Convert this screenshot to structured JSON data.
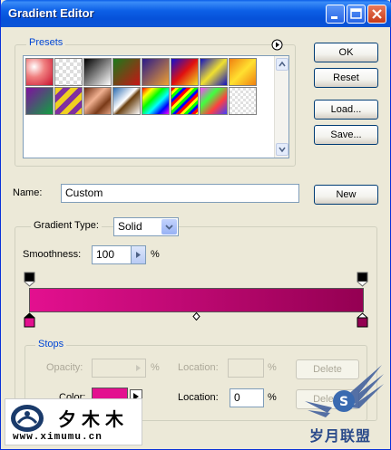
{
  "window": {
    "title": "Gradient Editor"
  },
  "presets": {
    "label": "Presets",
    "swatches": [
      {
        "name": "swatch-red-white",
        "bg": "radial-gradient(circle at 30% 30%, #ffffff 0%, #f08080 40%, #c8102e 100%)"
      },
      {
        "name": "swatch-transparent-white",
        "bg": "repeating-conic-gradient(#ddd 0% 25%, #fff 0% 50%) 0 0/8px 8px"
      },
      {
        "name": "swatch-black-white",
        "bg": "linear-gradient(135deg, #000 0%, #fff 100%)"
      },
      {
        "name": "swatch-red-green",
        "bg": "linear-gradient(135deg, #1a7a1a 0%, #c81414 100%)"
      },
      {
        "name": "swatch-violet-orange",
        "bg": "linear-gradient(135deg, #2a1a8a 0%, #f0a030 100%)"
      },
      {
        "name": "swatch-blue-red-yellow",
        "bg": "linear-gradient(135deg, #1010d0 0%, #e01010 50%, #f0e020 100%)"
      },
      {
        "name": "swatch-blue-yellow-blue",
        "bg": "linear-gradient(135deg, #1010c0 0%, #f0e030 50%, #1010c0 100%)"
      },
      {
        "name": "swatch-orange-yellow",
        "bg": "linear-gradient(135deg, #f08010 0%, #ffe030 50%, #f08010 100%)"
      },
      {
        "name": "swatch-violet-green",
        "bg": "linear-gradient(135deg, #8010a0 0%, #10a040 100%)"
      },
      {
        "name": "swatch-yellow-violet",
        "bg": "repeating-linear-gradient(135deg, #f0d020 0 6px, #8030a0 6px 12px)"
      },
      {
        "name": "swatch-copper",
        "bg": "linear-gradient(135deg, #6a2a10 0%, #f0b090 40%, #7a3a18 70%, #e0a080 100%)"
      },
      {
        "name": "swatch-chrome",
        "bg": "linear-gradient(135deg, #2a6ab0 0%, #ffffff 45%, #6a4010 55%, #ffffff 100%)"
      },
      {
        "name": "swatch-spectrum",
        "bg": "linear-gradient(135deg, #ff0000, #ffff00, #00ff00, #00ffff, #0000ff, #ff00ff)"
      },
      {
        "name": "swatch-rainbow-stripes",
        "bg": "repeating-linear-gradient(135deg, #ff0000 0 3px, #ffff00 3px 6px, #00ff00 6px 9px, #0000ff 9px 12px)"
      },
      {
        "name": "swatch-transparent-rainbow",
        "bg": "linear-gradient(135deg, #ff40ff 0%, #40ff40 35%, #ff4040 65%, #4040ff 100%)"
      },
      {
        "name": "swatch-transparent-stripes",
        "bg": "repeating-conic-gradient(#e0e0e0 0% 25%, #fff 0% 50%) 0 0/6px 6px"
      }
    ]
  },
  "buttons": {
    "ok": "OK",
    "reset": "Reset",
    "load": "Load...",
    "save": "Save...",
    "new": "New",
    "delete_opacity": "Delete",
    "delete_color": "Delete"
  },
  "name_field": {
    "label": "Name:",
    "value": "Custom"
  },
  "gradient_type": {
    "label": "Gradient Type:",
    "value": "Solid"
  },
  "smoothness": {
    "label": "Smoothness:",
    "value": "100",
    "unit": "%"
  },
  "gradient_colors": {
    "start": "#e3108f",
    "end": "#940052"
  },
  "stops": {
    "label": "Stops",
    "opacity_label": "Opacity:",
    "opacity_value": "",
    "opacity_unit": "%",
    "opacity_location_label": "Location:",
    "opacity_location_value": "",
    "opacity_location_unit": "%",
    "color_label": "Color:",
    "color_swatch": "#e3108f",
    "color_location_label": "Location:",
    "color_location_value": "0",
    "color_location_unit": "%"
  },
  "watermark": {
    "logo_text": "夕木木",
    "url": "www.ximumu.cn",
    "badge_text": "岁月联盟"
  }
}
